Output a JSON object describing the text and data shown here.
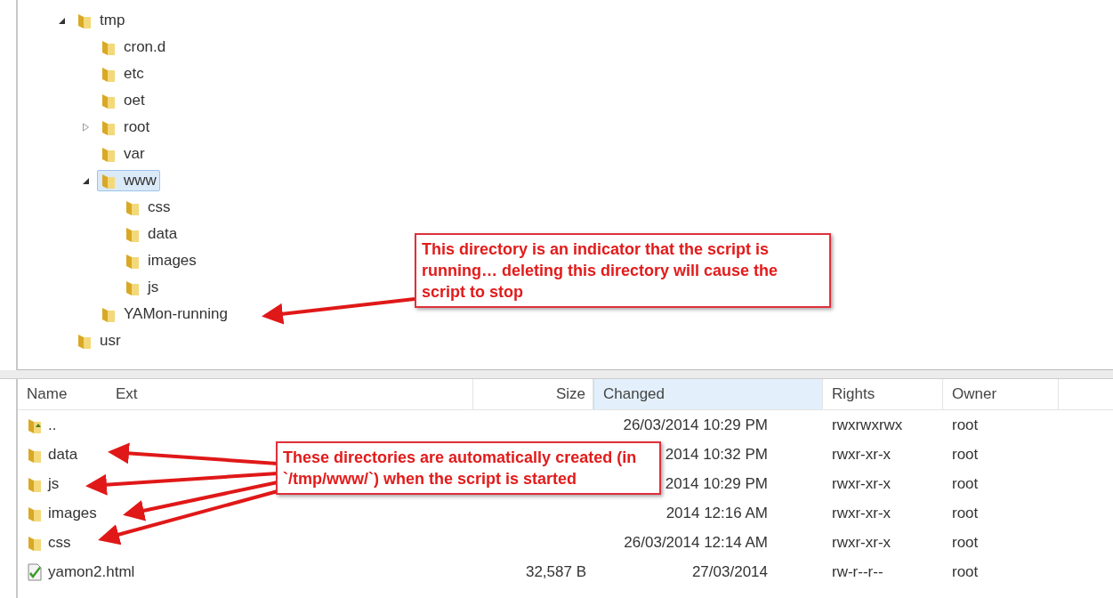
{
  "tree": [
    {
      "label": "tmp",
      "expanded": true,
      "selected": false,
      "children": [
        {
          "label": "cron.d",
          "selected": false
        },
        {
          "label": "etc",
          "selected": false
        },
        {
          "label": "oet",
          "selected": false
        },
        {
          "label": "root",
          "expanded": false,
          "selected": false
        },
        {
          "label": "var",
          "selected": false
        },
        {
          "label": "www",
          "expanded": true,
          "selected": true,
          "children": [
            {
              "label": "css",
              "selected": false
            },
            {
              "label": "data",
              "selected": false
            },
            {
              "label": "images",
              "selected": false
            },
            {
              "label": "js",
              "selected": false
            }
          ]
        },
        {
          "label": "YAMon-running",
          "selected": false
        }
      ]
    },
    {
      "label": "usr",
      "selected": false
    }
  ],
  "file_list": {
    "columns": [
      {
        "label": "Name",
        "sorted": false
      },
      {
        "label": "Ext",
        "sorted": false
      },
      {
        "label": "Size",
        "sorted": false
      },
      {
        "label": "Changed",
        "sorted": true
      },
      {
        "label": "Rights",
        "sorted": false
      },
      {
        "label": "Owner",
        "sorted": false
      }
    ],
    "rows": [
      {
        "kind": "parent",
        "name": "..",
        "changed": "26/03/2014 10:29 PM",
        "rights": "rwxrwxrwx",
        "owner": "root"
      },
      {
        "kind": "folder",
        "name": "data",
        "changed": "2014 10:32 PM",
        "rights": "rwxr-xr-x",
        "owner": "root"
      },
      {
        "kind": "folder",
        "name": "js",
        "changed": "2014 10:29 PM",
        "rights": "rwxr-xr-x",
        "owner": "root"
      },
      {
        "kind": "folder",
        "name": "images",
        "changed": "2014 12:16 AM",
        "rights": "rwxr-xr-x",
        "owner": "root"
      },
      {
        "kind": "folder",
        "name": "css",
        "changed": "26/03/2014 12:14 AM",
        "rights": "rwxr-xr-x",
        "owner": "root"
      },
      {
        "kind": "file",
        "name": "yamon2.html",
        "size": "32,587 B",
        "changed": "27/03/2014",
        "rights": "rw-r--r--",
        "owner": "root"
      }
    ]
  },
  "annotations": [
    {
      "text": "This directory is an indicator that the script is running… deleting this directory will cause the script to stop"
    },
    {
      "text": "These directories are automatically created (in `/tmp/www/`) when the script is started"
    }
  ]
}
